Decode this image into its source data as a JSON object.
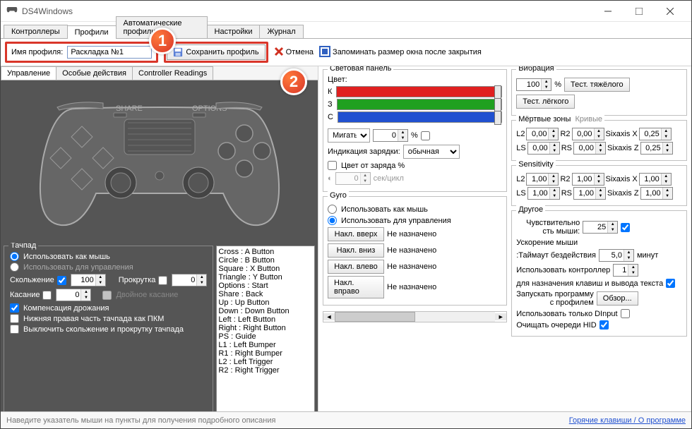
{
  "window": {
    "title": "DS4Windows"
  },
  "mainTabs": [
    "Контроллеры",
    "Профили",
    "Автоматические профили",
    "Настройки",
    "Журнал"
  ],
  "activeMainTab": 1,
  "toolbar": {
    "profileNameLabel": "Имя профиля:",
    "profileNameValue": "Раскладка №1",
    "saveProfile": "Сохранить профиль",
    "cancel": "Отмена",
    "rememberSize": "Запоминать размер окна после закрытия"
  },
  "callouts": {
    "one": "1",
    "two": "2"
  },
  "subTabs": [
    "Управление",
    "Особые действия",
    "Controller Readings"
  ],
  "activeSubTab": 0,
  "touchpad": {
    "legend": "Тачпад",
    "useAsMouse": "Использовать как мышь",
    "useForControls": "Использовать для управления",
    "slideLabel": "Скольжение",
    "slideValue": "100",
    "scrollLabel": "Прокрутка",
    "scrollValue": "0",
    "tapLabel": "Касание",
    "tapValue": "0",
    "doubleTap": "Двойное касание",
    "jitterComp": "Компенсация дрожания",
    "lowerRightRMB": "Нижняя правая часть тачпада как ПКМ",
    "disableSlideScroll": "Выключить скольжение и прокрутку тачпада"
  },
  "mappings": [
    "Cross : A Button",
    "Circle : B Button",
    "Square : X Button",
    "Triangle : Y Button",
    "Options : Start",
    "Share : Back",
    "Up : Up Button",
    "Down : Down Button",
    "Left : Left Button",
    "Right : Right Button",
    "PS : Guide",
    "L1 : Left Bumper",
    "R1 : Right Bumper",
    "L2 : Left Trigger",
    "R2 : Right Trigger"
  ],
  "lightbar": {
    "legend": "Световая панель",
    "colorLabel": "Цвет:",
    "r": "К",
    "g": "З",
    "b": "С",
    "flashLabel": "Мигать п",
    "flashValue": "0",
    "pct": "%",
    "chargingLabel": "Индикация зарядки:",
    "chargingValue": "обычная",
    "colorByBattery": "Цвет от заряда %",
    "pulseValue": "0",
    "pulseUnit": "сек/цикл"
  },
  "gyro": {
    "legend": "Gyro",
    "useAsMouse": "Использовать как мышь",
    "useForControls": "Использовать для управления",
    "tiltUp": "Накл. вверх",
    "tiltDown": "Накл. вниз",
    "tiltLeft": "Накл. влево",
    "tiltRight": "Накл. вправо",
    "unassigned": "Не назначено"
  },
  "rumble": {
    "legend": "Вибрация",
    "value": "100",
    "pct": "%",
    "testHeavy": "Тест. тяжёлого",
    "testLight": "Тест. лёгкого"
  },
  "deadzone": {
    "legend": "Мёртвые зоны",
    "curves": "Кривые",
    "L2": "L2",
    "R2": "R2",
    "LS": "LS",
    "RS": "RS",
    "sixX": "Sixaxis X",
    "sixZ": "Sixaxis Z",
    "v000": "0,00",
    "v025": "0,25"
  },
  "sensitivity": {
    "legend": "Sensitivity",
    "v100": "1,00"
  },
  "other": {
    "legend": "Другое",
    "mouseSensLabel": "Чувствительно\nсть мыши:",
    "mouseSensValue": "25",
    "mouseAccel": "Ускорение мыши",
    "idleLabel": ":Таймаут бездействия",
    "idleValue": "5,0",
    "idleUnit": "минут",
    "useControllerLabel": "Использовать контроллер",
    "useControllerValue": "1",
    "forKeysText": "для назначения клавиш и вывода текста",
    "launchWithProfile": "Запускать программу\nс профилем",
    "browse": "Обзор...",
    "dinputOnly": "Использовать только DInput",
    "flushHID": "Очищать очереди HID"
  },
  "footer": {
    "hint": "Наведите указатель мыши на пункты для получения подробного описания",
    "hotkeys": "Горячие клавиши / О программе"
  }
}
